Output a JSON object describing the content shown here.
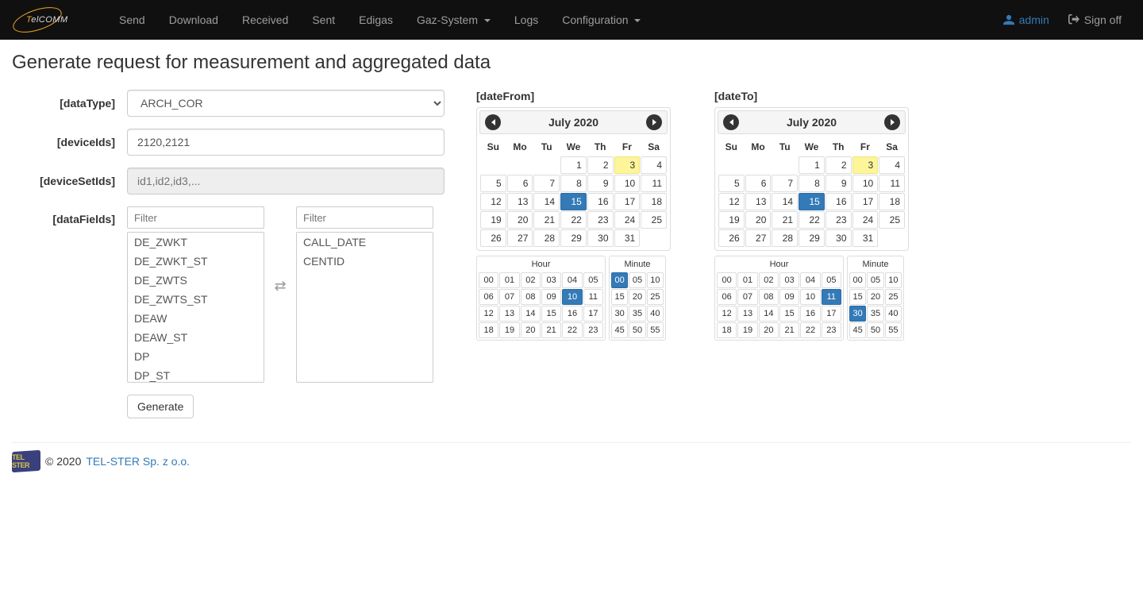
{
  "brand": {
    "textPart1": "T",
    "textPart2": "elCOMM"
  },
  "nav": {
    "items": [
      {
        "label": "Send"
      },
      {
        "label": "Download"
      },
      {
        "label": "Received"
      },
      {
        "label": "Sent"
      },
      {
        "label": "Edigas"
      },
      {
        "label": "Gaz-System",
        "caret": true
      },
      {
        "label": "Logs"
      },
      {
        "label": "Configuration",
        "caret": true
      }
    ],
    "user": "admin",
    "signoff": "Sign off"
  },
  "page": {
    "title": "Generate request for measurement and aggregated data"
  },
  "form": {
    "dataTypeLabel": "[dataType]",
    "dataTypeValue": "ARCH_COR",
    "deviceIdsLabel": "[deviceIds]",
    "deviceIdsValue": "2120,2121",
    "deviceSetIdsLabel": "[deviceSetIds]",
    "deviceSetIdsPlaceholder": "id1,id2,id3,...",
    "dataFieldsLabel": "[dataFields]",
    "filterPlaceholder": "Filter",
    "availableFields": [
      "DE_ZWKT",
      "DE_ZWKT_ST",
      "DE_ZWTS",
      "DE_ZWTS_ST",
      "DEAW",
      "DEAW_ST",
      "DP",
      "DP_ST"
    ],
    "selectedFields": [
      "CALL_DATE",
      "CENTID"
    ],
    "generateLabel": "Generate"
  },
  "dateFrom": {
    "label": "[dateFrom]",
    "monthTitle": "July 2020",
    "dow": [
      "Su",
      "Mo",
      "Tu",
      "We",
      "Th",
      "Fr",
      "Sa"
    ],
    "selectedDay": 15,
    "todayDay": 3,
    "hourLabel": "Hour",
    "minuteLabel": "Minute",
    "selectedHour": "10",
    "selectedMinute": "00"
  },
  "dateTo": {
    "label": "[dateTo]",
    "monthTitle": "July 2020",
    "dow": [
      "Su",
      "Mo",
      "Tu",
      "We",
      "Th",
      "Fr",
      "Sa"
    ],
    "selectedDay": 15,
    "todayDay": 3,
    "hourLabel": "Hour",
    "minuteLabel": "Minute",
    "selectedHour": "11",
    "selectedMinute": "30"
  },
  "footer": {
    "copy": "© 2020 ",
    "linkText": "TEL-STER Sp. z o.o.",
    "logoText": "TEL STER"
  }
}
